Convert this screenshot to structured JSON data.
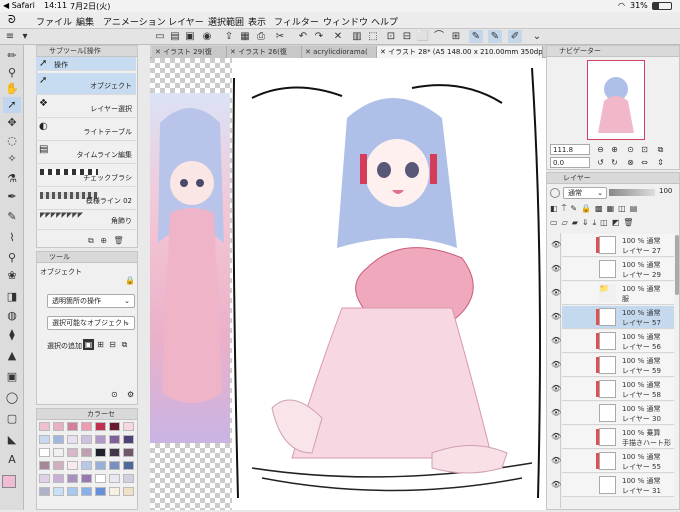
{
  "status": {
    "back": "◀ Safari",
    "time": "14:11",
    "date": "7月2日(火)",
    "battery": "31%"
  },
  "menu": [
    "ファイル",
    "編集",
    "アニメーション",
    "レイヤー",
    "選択範囲",
    "表示",
    "フィルター",
    "ウィンドウ",
    "ヘルプ"
  ],
  "subtool": {
    "title": "サブツール[操作",
    "section": "操作",
    "items": [
      {
        "label": "オブジェクト",
        "selected": true
      },
      {
        "label": "レイヤー選択",
        "selected": false
      },
      {
        "label": "ライトテーブル",
        "selected": false
      },
      {
        "label": "タイムライン編集",
        "selected": false
      }
    ],
    "brushes": [
      "チェックブラシ",
      "模様ライン 02",
      "角飾り"
    ]
  },
  "toolprop": {
    "tab": "ツール",
    "heading": "オブジェクト",
    "transparent_op": "透明箇所の操作",
    "selectable_obj": "選択可能なオブジェクト",
    "selection_add": "選択の追加"
  },
  "color": {
    "tab": "カラーセ",
    "swatches": [
      "#f1c0d0",
      "#e8b0c0",
      "#d08098",
      "#f09cb0",
      "#c03050",
      "#6a1830",
      "#f8d8e0",
      "#c8d8f0",
      "#a0b8e0",
      "#e8e0f0",
      "#d0c0e0",
      "#b098c8",
      "#806098",
      "#504078",
      "#ffffff",
      "#f0f0f0",
      "#d8b8c8",
      "#c0a0b0",
      "#202030",
      "#403848",
      "#705868",
      "#a88898",
      "#d0b0c0",
      "#f8e8f0",
      "#b8c8e8",
      "#98b0d8",
      "#7890c0",
      "#506898",
      "#e0d0e8",
      "#c8b0d8",
      "#a890c0",
      "#9878b0",
      "#ffffff",
      "#e8e8f0",
      "#d0d0e0",
      "#b0b0c8",
      "#c8e0f8",
      "#a8c8f0",
      "#88b0e8",
      "#6890d8",
      "#f8f0e0",
      "#f0e0c8"
    ]
  },
  "tabs": [
    {
      "label": "イラスト 29(復",
      "active": false
    },
    {
      "label": "イラスト 26(復",
      "active": false
    },
    {
      "label": "acrylicdiorama(",
      "active": false
    },
    {
      "label": "イラスト 28* (A5 148.00 x 210.00mm 350dpi 111.8%)",
      "active": true
    }
  ],
  "navigator": {
    "title": "ナビゲーター",
    "zoom": "111.8",
    "angle": "0.0"
  },
  "layers": {
    "title": "レイヤー",
    "blend": "通常",
    "opacity": "100",
    "items": [
      {
        "mode": "100 % 通常",
        "name": "レイヤー 27",
        "red": true,
        "folder": false,
        "selected": false
      },
      {
        "mode": "100 % 通常",
        "name": "レイヤー 29",
        "red": false,
        "folder": false,
        "selected": false
      },
      {
        "mode": "100 % 通常",
        "name": "服",
        "red": false,
        "folder": true,
        "selected": false
      },
      {
        "mode": "100 % 通常",
        "name": "レイヤー 57",
        "red": true,
        "folder": false,
        "selected": true
      },
      {
        "mode": "100 % 通常",
        "name": "レイヤー 56",
        "red": true,
        "folder": false,
        "selected": false
      },
      {
        "mode": "100 % 通常",
        "name": "レイヤー 59",
        "red": true,
        "folder": false,
        "selected": false
      },
      {
        "mode": "100 % 通常",
        "name": "レイヤー 58",
        "red": true,
        "folder": false,
        "selected": false
      },
      {
        "mode": "100 % 通常",
        "name": "レイヤー 30",
        "red": false,
        "folder": false,
        "selected": false
      },
      {
        "mode": "100 % 乗算",
        "name": "手描きハート形",
        "red": true,
        "folder": false,
        "selected": false
      },
      {
        "mode": "100 % 通常",
        "name": "レイヤー 55",
        "red": true,
        "folder": false,
        "selected": false
      },
      {
        "mode": "100 % 通常",
        "name": "レイヤー 31",
        "red": false,
        "folder": false,
        "selected": false
      }
    ]
  }
}
